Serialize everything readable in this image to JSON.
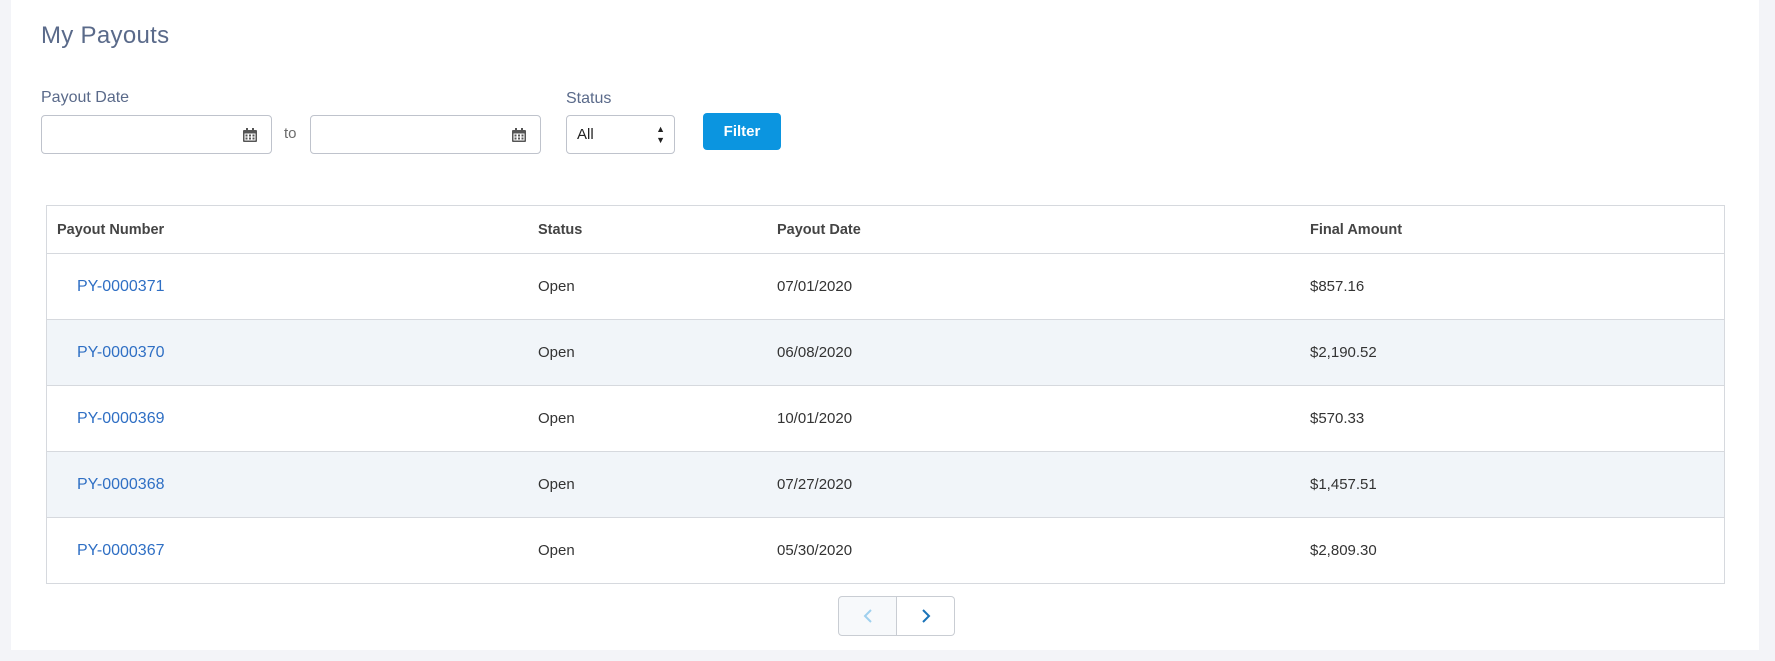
{
  "page": {
    "title": "My Payouts"
  },
  "filters": {
    "payout_date_label": "Payout Date",
    "from_value": "",
    "to_text": "to",
    "to_value": "",
    "status_label": "Status",
    "status_value": "All",
    "filter_button": "Filter"
  },
  "table": {
    "headers": [
      "Payout Number",
      "Status",
      "Payout Date",
      "Final Amount"
    ],
    "rows": [
      {
        "number": "PY-0000371",
        "status": "Open",
        "date": "07/01/2020",
        "amount": "$857.16"
      },
      {
        "number": "PY-0000370",
        "status": "Open",
        "date": "06/08/2020",
        "amount": "$2,190.52"
      },
      {
        "number": "PY-0000369",
        "status": "Open",
        "date": "10/01/2020",
        "amount": "$570.33"
      },
      {
        "number": "PY-0000368",
        "status": "Open",
        "date": "07/27/2020",
        "amount": "$1,457.51"
      },
      {
        "number": "PY-0000367",
        "status": "Open",
        "date": "05/30/2020",
        "amount": "$2,809.30"
      }
    ]
  },
  "pagination": {
    "prev_icon": "chevron-left-icon",
    "next_icon": "chevron-right-icon"
  },
  "colors": {
    "accent": "#0b95e0",
    "link": "#2f6fc4",
    "row_alt": "#f1f5f9"
  }
}
